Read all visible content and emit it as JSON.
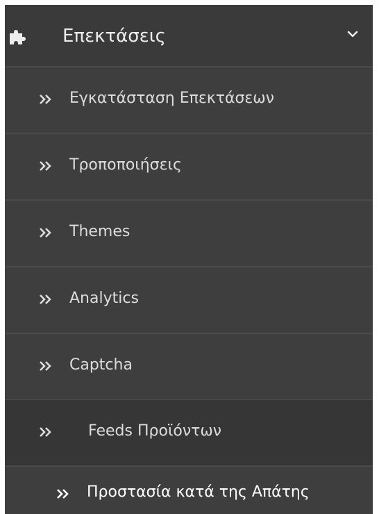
{
  "menu": {
    "header": {
      "label": "Επεκτάσεις",
      "icon": "puzzle-piece-icon",
      "expand_icon": "chevron-down-icon"
    },
    "items": [
      {
        "label": "Εγκατάσταση Επεκτάσεων",
        "icon": "double-chevron-right-icon"
      },
      {
        "label": "Τροποποιήσεις",
        "icon": "double-chevron-right-icon"
      },
      {
        "label": "Themes",
        "icon": "double-chevron-right-icon"
      },
      {
        "label": "Analytics",
        "icon": "double-chevron-right-icon"
      },
      {
        "label": "Captcha",
        "icon": "double-chevron-right-icon"
      },
      {
        "label": "Feeds Προϊόντων",
        "icon": "double-chevron-right-icon",
        "active": true
      },
      {
        "label": "Προστασία κατά της Απάτης",
        "icon": "double-chevron-right-icon"
      }
    ]
  },
  "colors": {
    "panel_bg": "#3e3e3e",
    "active_bg": "#363636",
    "divider": "#4b4b4b",
    "text": "#dcdcdc",
    "text_bright": "#ffffff"
  }
}
